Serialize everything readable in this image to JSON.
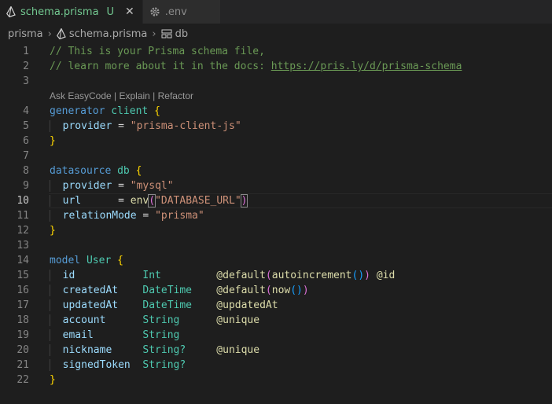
{
  "tabs": [
    {
      "label": "schema.prisma",
      "status": "U",
      "active": true
    },
    {
      "label": ".env",
      "active": false
    }
  ],
  "breadcrumb": [
    "prisma",
    "schema.prisma",
    "db"
  ],
  "codelens": "Ask EasyCode | Explain | Refactor",
  "current_line": 10,
  "lines": {
    "l1": "// This is your Prisma schema file,",
    "l2a": "// learn more about it in the docs: ",
    "l2b": "https://pris.ly/d/prisma-schema",
    "l4a": "generator",
    "l4b": "client",
    "l5a": "provider",
    "l5b": "\"prisma-client-js\"",
    "l8a": "datasource",
    "l8b": "db",
    "l9a": "provider",
    "l9b": "\"mysql\"",
    "l10a": "url",
    "l10b": "env",
    "l10c": "\"DATABASE_URL\"",
    "l11a": "relationMode",
    "l11b": "\"prisma\"",
    "l14a": "model",
    "l14b": "User",
    "fields": [
      {
        "name": "id",
        "type": "Int",
        "attr": "@default",
        "attr_arg": "autoincrement",
        "extra": "@id"
      },
      {
        "name": "createdAt",
        "type": "DateTime",
        "attr": "@default",
        "attr_arg": "now"
      },
      {
        "name": "updatedAt",
        "type": "DateTime",
        "attr": "@updatedAt"
      },
      {
        "name": "account",
        "type": "String",
        "attr": "@unique"
      },
      {
        "name": "email",
        "type": "String"
      },
      {
        "name": "nickname",
        "type": "String?",
        "attr": "@unique"
      },
      {
        "name": "signedToken",
        "type": "String?"
      }
    ]
  },
  "line_numbers": [
    "1",
    "2",
    "3",
    "4",
    "5",
    "6",
    "7",
    "8",
    "9",
    "10",
    "11",
    "12",
    "13",
    "14",
    "15",
    "16",
    "17",
    "18",
    "19",
    "20",
    "21",
    "22"
  ]
}
